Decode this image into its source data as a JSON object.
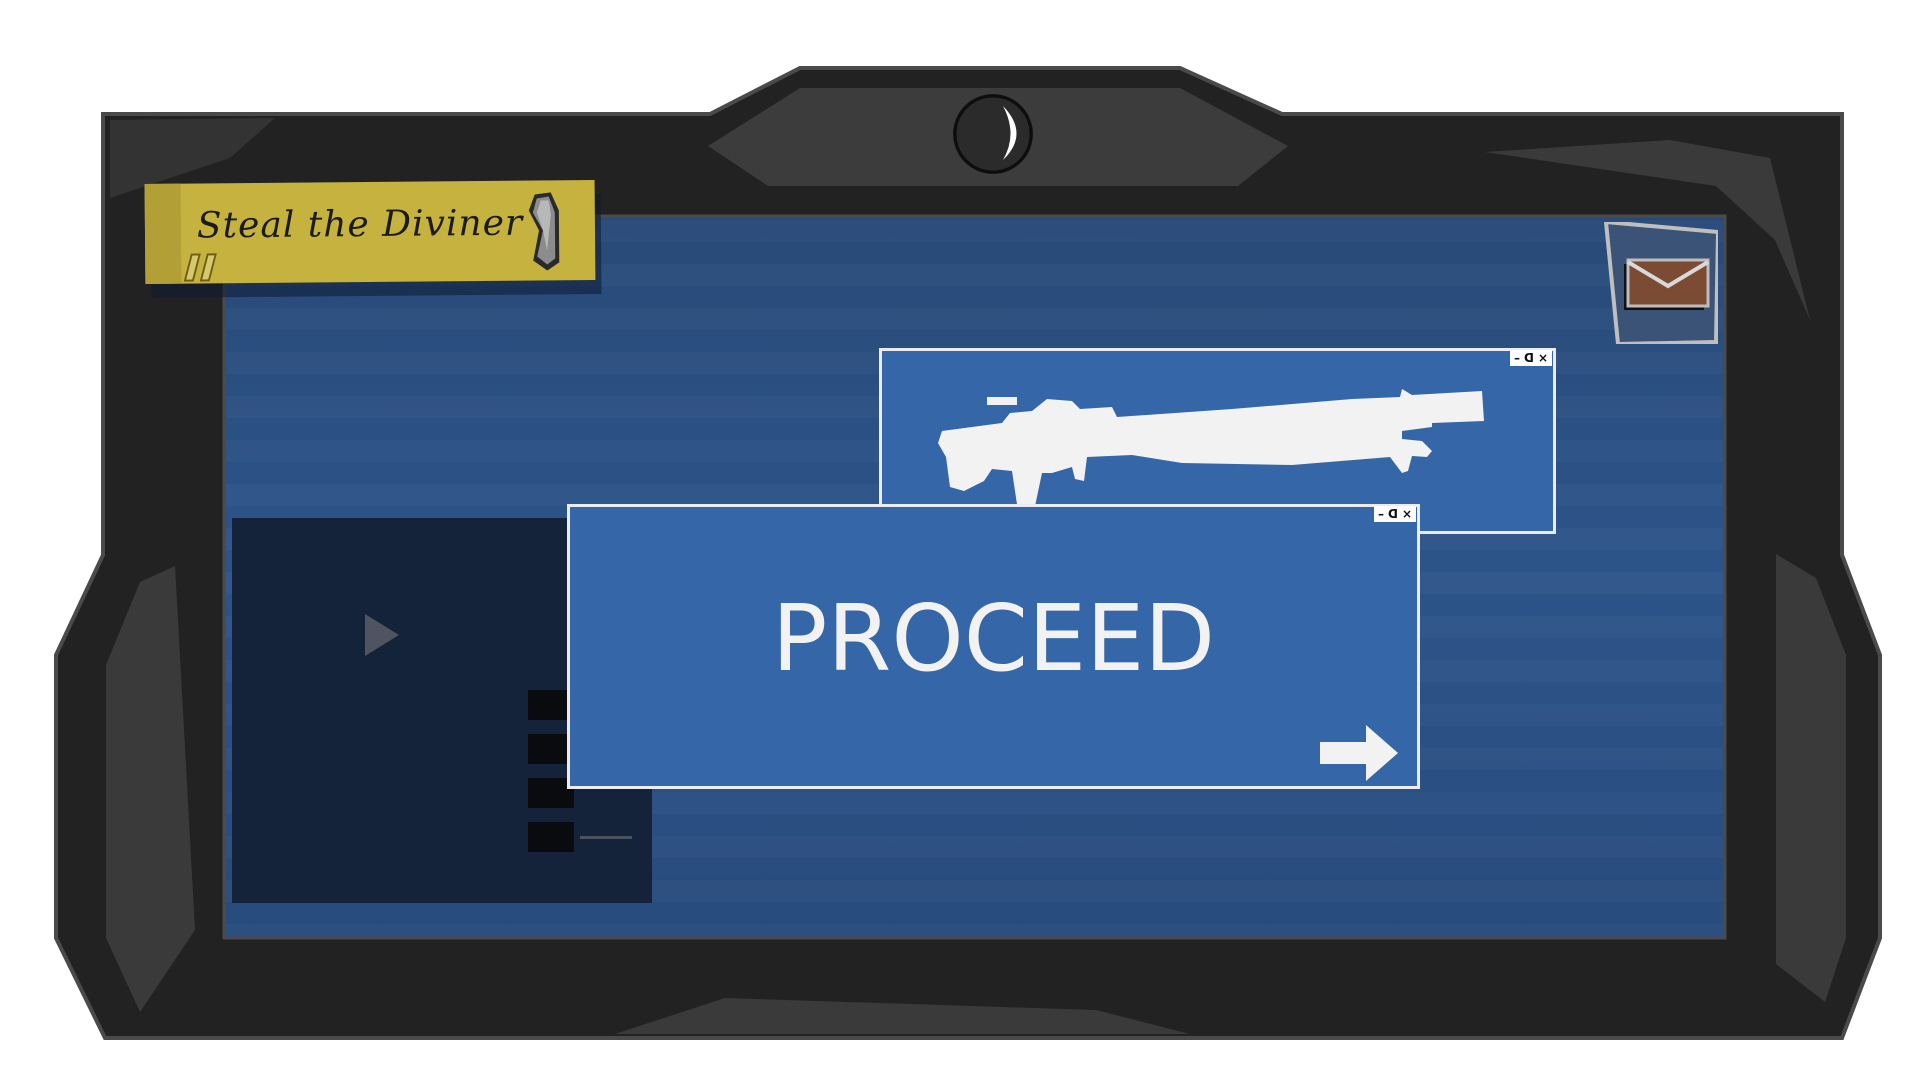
{
  "mission_note": {
    "title": "Steal the Diviner",
    "icon": "diviner-crystal-icon"
  },
  "notifications": {
    "icon": "mail-icon"
  },
  "video_panel": {
    "icon": "play-icon",
    "bar_count": 4
  },
  "weapon_window": {
    "icon": "rifle-silhouette-icon",
    "controls": {
      "minimize": "–",
      "restore": "ᗡ",
      "close": "×"
    }
  },
  "proceed_window": {
    "label": "PROCEED",
    "icon": "arrow-right-icon",
    "controls": {
      "minimize": "–",
      "restore": "ᗡ",
      "close": "×"
    }
  },
  "colors": {
    "frame": "#222222",
    "frame_accent": "#3c3c3c",
    "screen": "#2a4f82",
    "window": "#3566a7",
    "note": "#c6b33f",
    "mail": "#7b4b33"
  }
}
